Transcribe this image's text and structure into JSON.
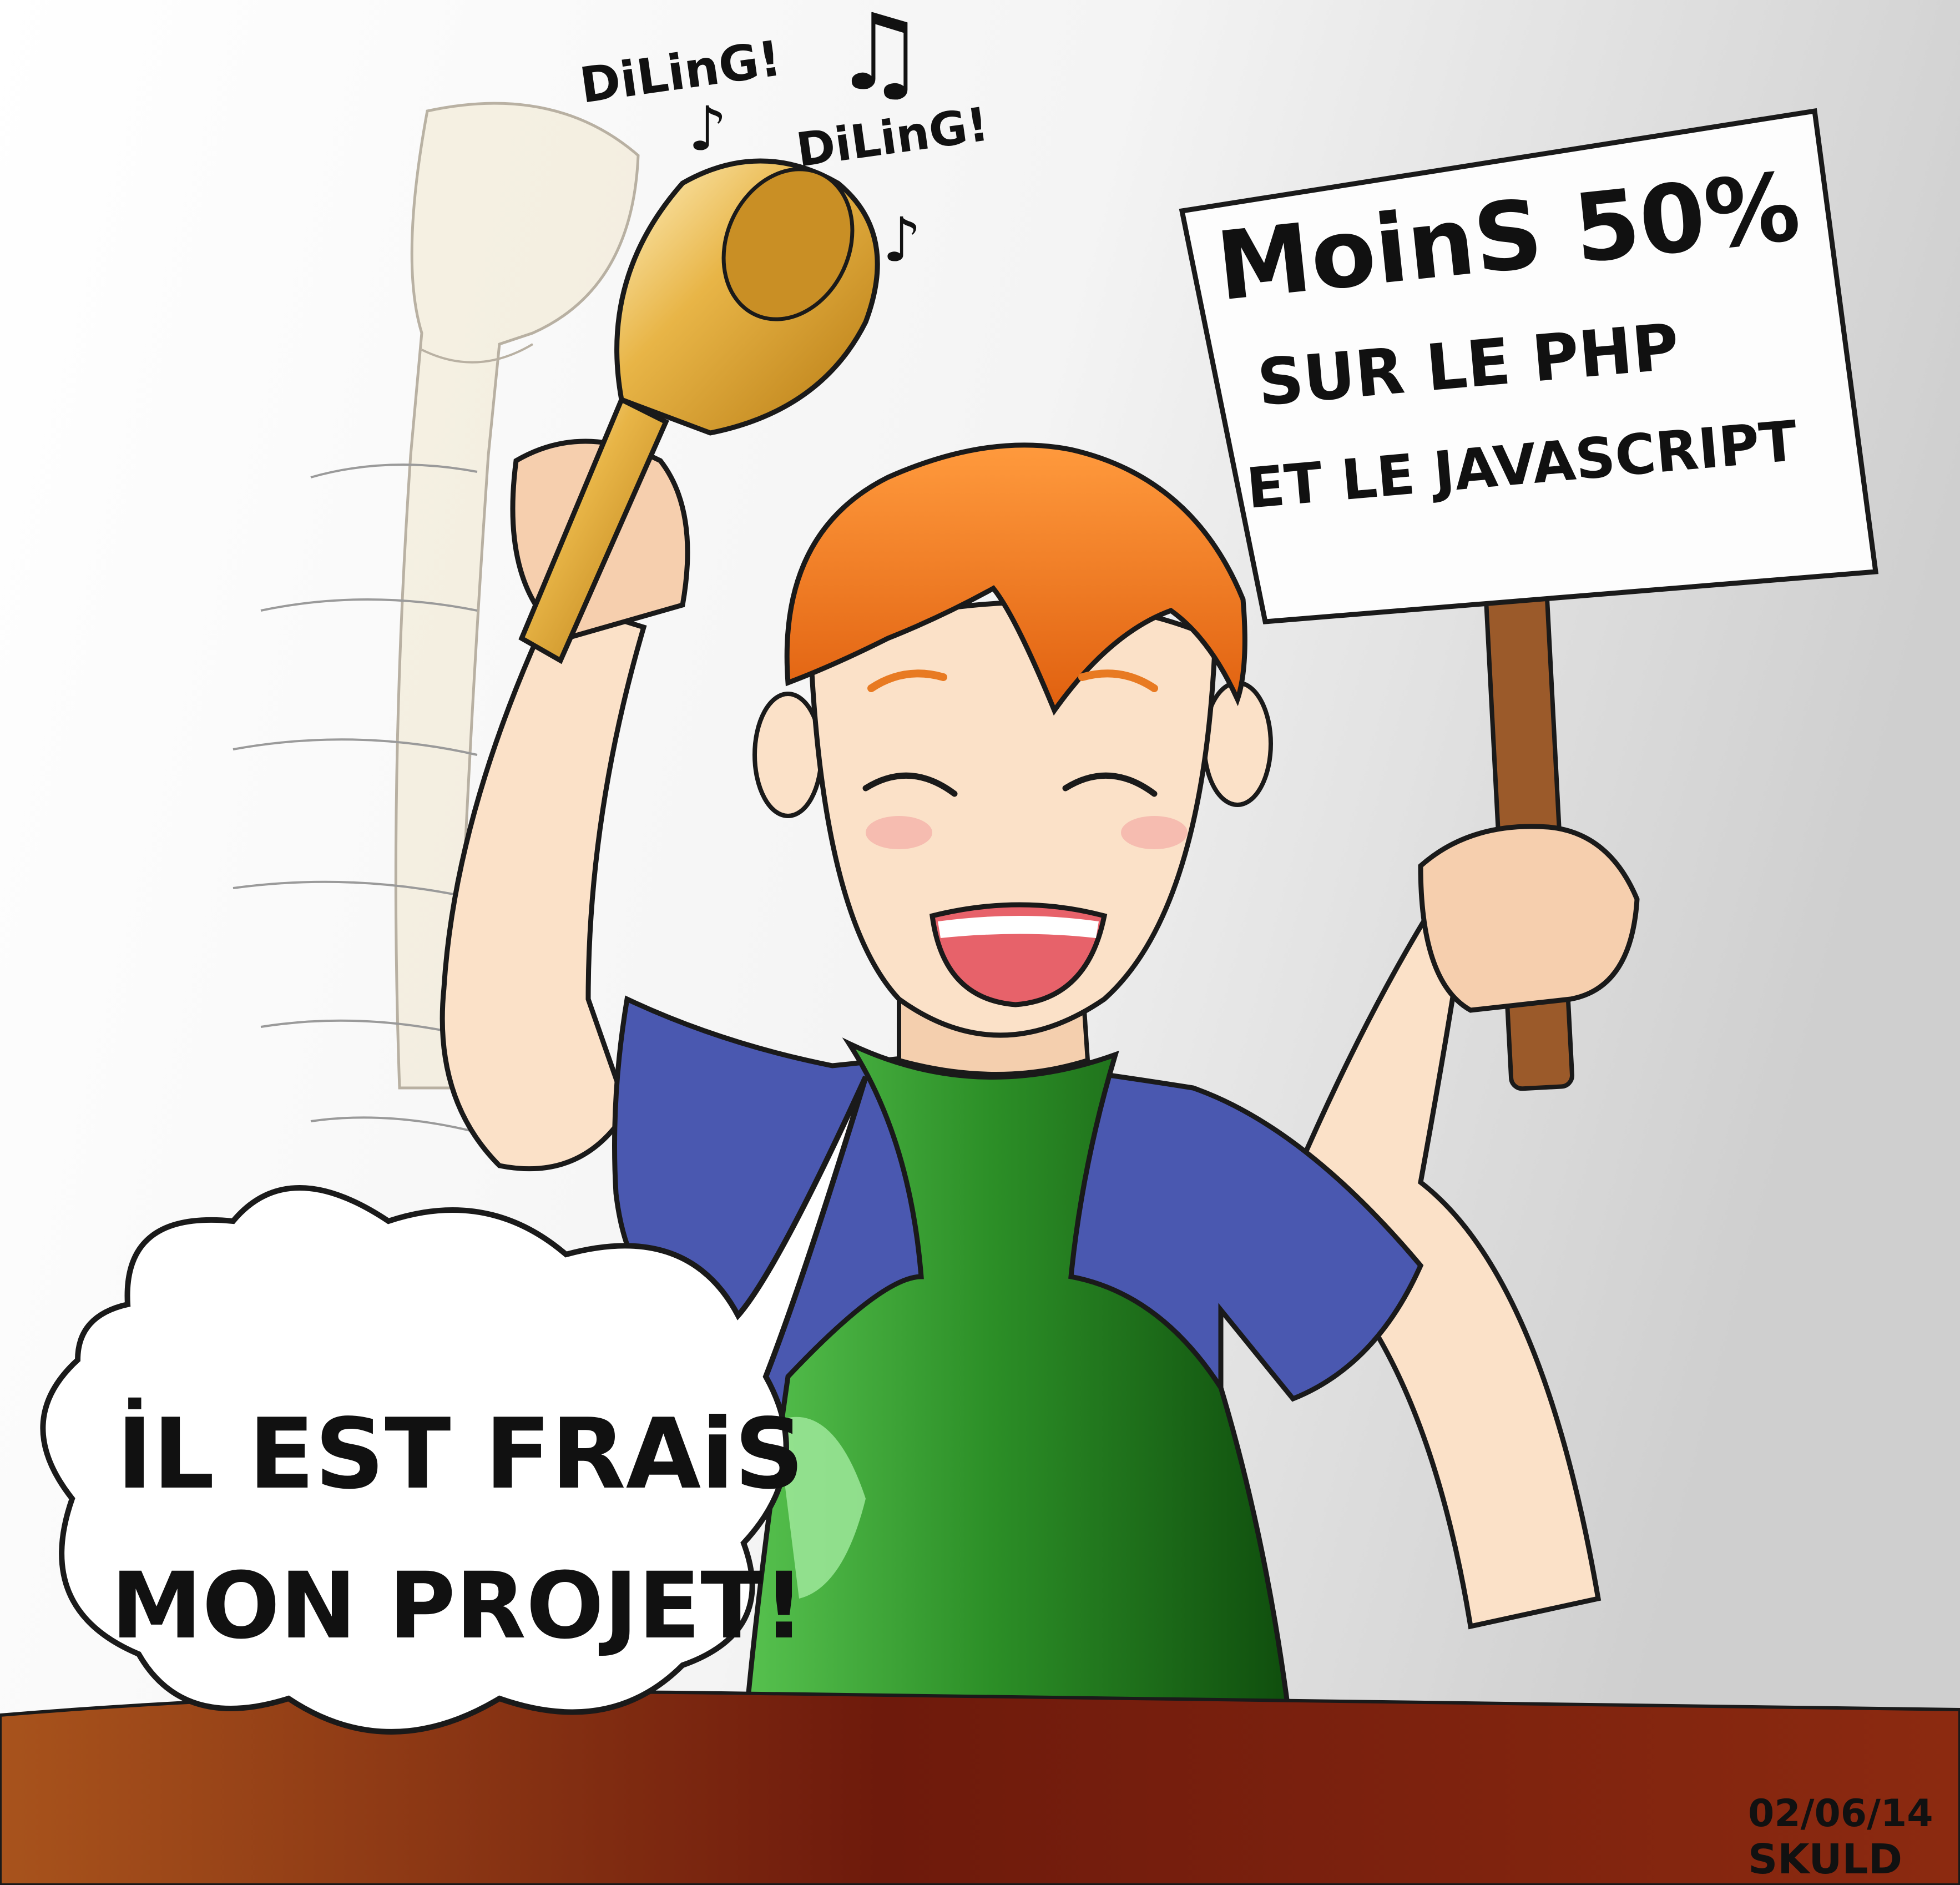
{
  "sound_effects": [
    "DiLinG!",
    "DiLinG!"
  ],
  "sign": {
    "line1": "MoinS 50%",
    "line2": "SUR LE PHP",
    "line3": "ET LE JAVASCRIPT"
  },
  "speech_bubble": {
    "line1": "İL EST FRAiS",
    "line2": "MON PROJET!"
  },
  "signature": {
    "date": "02/06/14",
    "author": "SKULD"
  },
  "colors": {
    "background_light": "#ffffff",
    "background_grey": "#d4d4d4",
    "hair": "#f07a1c",
    "skin": "#fbe1c8",
    "shirt": "#4a58b0",
    "apron": "#2f8f2a",
    "apron_highlight": "#8fe08a",
    "counter": "#7a1f0c",
    "bell": "#e0a83a",
    "sign_stick": "#9b5a2a"
  }
}
